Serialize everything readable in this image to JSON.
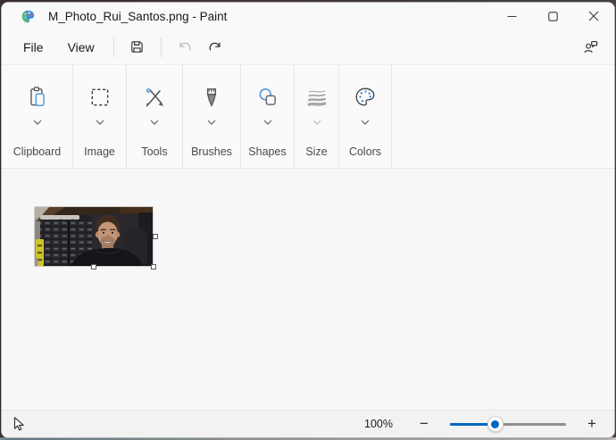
{
  "window": {
    "title": "M_Photo_Rui_Santos.png - Paint",
    "app_icon": "paint-app-icon",
    "controls": [
      {
        "name": "minimize"
      },
      {
        "name": "maximize"
      },
      {
        "name": "close"
      }
    ]
  },
  "menubar": {
    "items": [
      {
        "label": "File"
      },
      {
        "label": "View"
      }
    ],
    "icon_buttons": [
      {
        "name": "save-icon",
        "enabled": true
      },
      {
        "name": "undo-icon",
        "enabled": false
      },
      {
        "name": "redo-icon",
        "enabled": true
      },
      {
        "name": "feedback-icon",
        "enabled": true
      }
    ]
  },
  "ribbon": {
    "groups": [
      {
        "label": "Clipboard",
        "icon": "clipboard-icon"
      },
      {
        "label": "Image",
        "icon": "rectangle-select-icon"
      },
      {
        "label": "Tools",
        "icon": "crossed-pens-icon"
      },
      {
        "label": "Brushes",
        "icon": "brush-icon"
      },
      {
        "label": "Shapes",
        "icon": "circle-square-icon"
      },
      {
        "label": "Size",
        "icon": "line-thickness-icon"
      },
      {
        "label": "Colors",
        "icon": "palette-icon"
      }
    ]
  },
  "canvas": {
    "photo_description": "Small photo of a smiling young man with short dark hair and stubble wearing a dark hoodie, in front of a wall of dark electronics storage drawers, with a yellow tool at the left edge",
    "selection_handles": [
      "right-middle",
      "bottom-middle",
      "bottom-right"
    ]
  },
  "statusbar": {
    "cursor_icon": "pointer-icon",
    "zoom_label": "100%",
    "zoom_slider_percent": 39,
    "zoom_out_glyph": "−",
    "zoom_in_glyph": "+"
  },
  "colors": {
    "accent": "#0067c0",
    "icon_blue": "#4d94d6",
    "chrome_bg": "#f9f9f9",
    "workarea_bg": "#f7f7f8",
    "statusbar_bg": "#f2f2f3",
    "disabled_icon": "#bcbcbc"
  }
}
